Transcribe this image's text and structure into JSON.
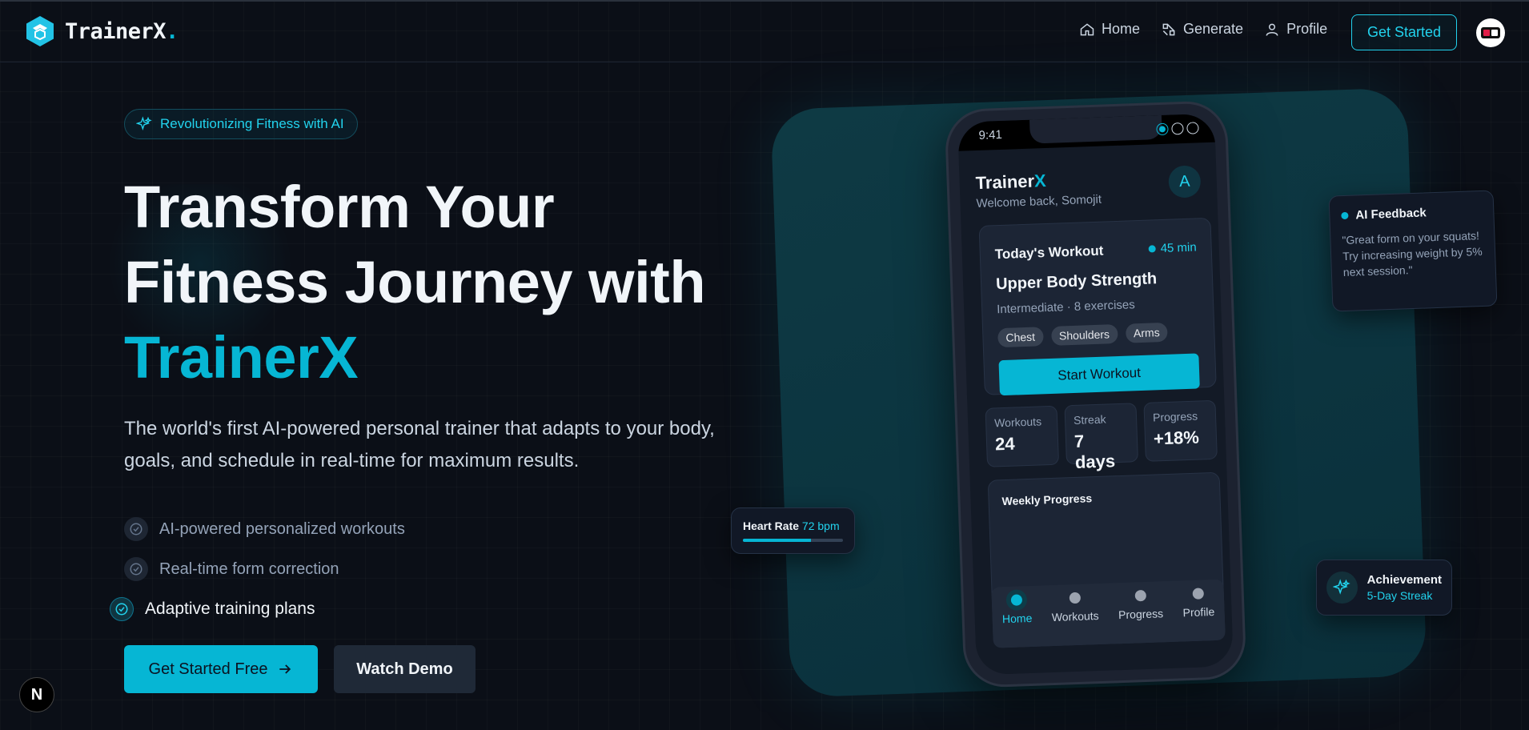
{
  "nav": {
    "brand_name": "TrainerX",
    "brand_dot": ".",
    "links": [
      {
        "label": "Home",
        "icon": "home-icon"
      },
      {
        "label": "Generate",
        "icon": "generate-icon"
      },
      {
        "label": "Profile",
        "icon": "user-icon"
      }
    ],
    "cta_label": "Get Started"
  },
  "hero": {
    "badge": "Revolutionizing Fitness with AI",
    "title_line1": "Transform Your",
    "title_line2": "Fitness Journey with",
    "title_accent": "TrainerX",
    "subtitle": "The world's first AI-powered personal trainer that adapts to your body, goals, and schedule in real-time for maximum results.",
    "features": [
      "AI-powered personalized workouts",
      "Real-time form correction",
      "Adaptive training plans"
    ],
    "primary_cta": "Get Started Free",
    "secondary_cta": "Watch Demo"
  },
  "phone": {
    "time": "9:41",
    "app_title": "Trainer",
    "app_title_accent": "X",
    "welcome": "Welcome back, Somojit",
    "avatar_initial": "A",
    "workout": {
      "heading": "Today's Workout",
      "duration": "45 min",
      "name": "Upper Body Strength",
      "meta": "Intermediate · 8 exercises",
      "tags": [
        "Chest",
        "Shoulders",
        "Arms"
      ],
      "start_label": "Start Workout"
    },
    "stats": [
      {
        "label": "Workouts",
        "value": "24"
      },
      {
        "label": "Streak",
        "value": "7 days"
      },
      {
        "label": "Progress",
        "value": "+18%"
      }
    ],
    "weekly_title": "Weekly Progress",
    "tabs": [
      "Home",
      "Workouts",
      "Progress",
      "Profile"
    ]
  },
  "feedback": {
    "title": "AI Feedback",
    "text": "\"Great form on your squats! Try increasing weight by 5% next session.\""
  },
  "heart_rate": {
    "label": "Heart Rate",
    "value": "72 bpm",
    "level": 0.68
  },
  "achievement": {
    "title": "Achievement",
    "subtitle": "5-Day Streak"
  },
  "colors": {
    "accent": "#06b6d4",
    "background": "#0b0f17",
    "panel": "#0e3a44"
  }
}
